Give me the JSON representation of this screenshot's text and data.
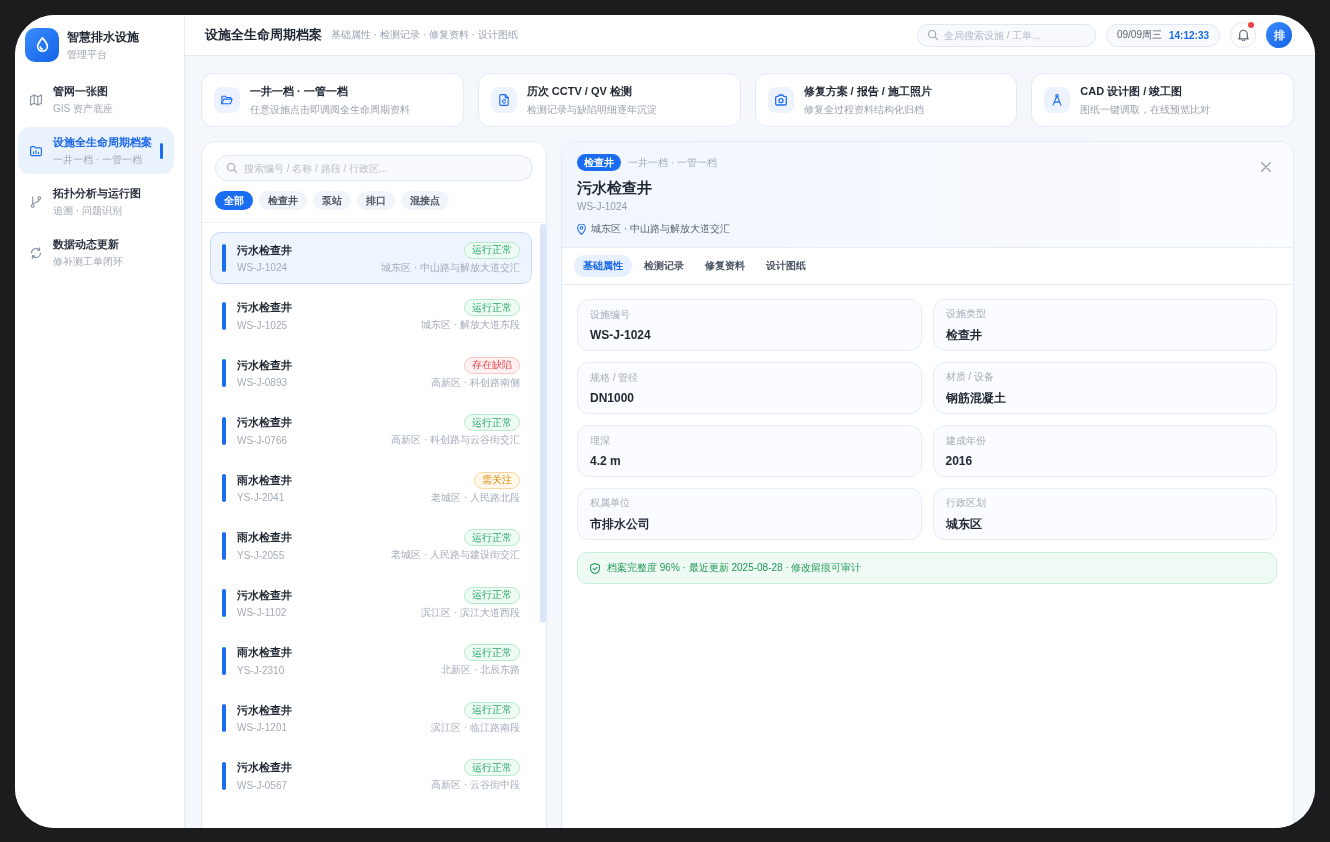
{
  "app": {
    "name": "智慧排水设施",
    "subtitle": "管理平台"
  },
  "sidebar": {
    "items": [
      {
        "title": "管网一张图",
        "subtitle": "GIS 资产底座",
        "selected": false
      },
      {
        "title": "设施全生命周期档案",
        "subtitle": "一井一档 · 一管一档",
        "selected": true
      },
      {
        "title": "拓扑分析与运行图",
        "subtitle": "追溯 · 问题识别",
        "selected": false
      },
      {
        "title": "数据动态更新",
        "subtitle": "修补测工单闭环",
        "selected": false
      }
    ]
  },
  "header": {
    "title": "设施全生命周期档案",
    "breadcrumb": "基础属性 · 检测记录 · 修复资料 · 设计图纸",
    "search": {
      "placeholder": "全局搜索设施 / 工单..."
    },
    "date": "09/09周三",
    "time": "14:12:33",
    "notifications": {
      "unread": true
    },
    "avatar": "排"
  },
  "feature_cards": [
    {
      "title": "一井一档 · 一管一档",
      "description": "任意设施点击即调阅全生命周期资料"
    },
    {
      "title": "历次 CCTV / QV 检测",
      "description": "检测记录与缺陷明细逐年沉淀"
    },
    {
      "title": "修复方案 / 报告 / 施工照片",
      "description": "修复全过程资料结构化归档"
    },
    {
      "title": "CAD 设计图 / 竣工图",
      "description": "图纸一键调取，在线预览比对"
    }
  ],
  "facility_list": {
    "search": {
      "placeholder": "搜索编号 / 名称 / 路段 / 行政区..."
    },
    "filters": [
      {
        "label": "全部",
        "selected": true
      },
      {
        "label": "检查井",
        "selected": false
      },
      {
        "label": "泵站",
        "selected": false
      },
      {
        "label": "排口",
        "selected": false
      },
      {
        "label": "混接点",
        "selected": false
      }
    ],
    "items": [
      {
        "name": "污水检查井",
        "code": "WS-J-1024",
        "location": "城东区 · 中山路与解放大道交汇",
        "kind": "normal",
        "status_label": "运行正常",
        "selected": true
      },
      {
        "name": "污水检查井",
        "code": "WS-J-1025",
        "location": "城东区 · 解放大道东段",
        "kind": "normal",
        "status_label": "运行正常",
        "selected": false
      },
      {
        "name": "污水检查井",
        "code": "WS-J-0893",
        "location": "高新区 · 科创路南侧",
        "kind": "defect",
        "status_label": "存在缺陷",
        "selected": false
      },
      {
        "name": "污水检查井",
        "code": "WS-J-0766",
        "location": "高新区 · 科创路与云谷街交汇",
        "kind": "normal",
        "status_label": "运行正常",
        "selected": false
      },
      {
        "name": "雨水检查井",
        "code": "YS-J-2041",
        "location": "老城区 · 人民路北段",
        "kind": "attention",
        "status_label": "需关注",
        "selected": false
      },
      {
        "name": "雨水检查井",
        "code": "YS-J-2055",
        "location": "老城区 · 人民路与建设街交汇",
        "kind": "normal",
        "status_label": "运行正常",
        "selected": false
      },
      {
        "name": "污水检查井",
        "code": "WS-J-1102",
        "location": "滨江区 · 滨江大道西段",
        "kind": "normal",
        "status_label": "运行正常",
        "selected": false
      },
      {
        "name": "雨水检查井",
        "code": "YS-J-2310",
        "location": "北新区 · 北辰东路",
        "kind": "normal",
        "status_label": "运行正常",
        "selected": false
      },
      {
        "name": "污水检查井",
        "code": "WS-J-1201",
        "location": "滨江区 · 临江路南段",
        "kind": "normal",
        "status_label": "运行正常",
        "selected": false
      },
      {
        "name": "污水检查井",
        "code": "WS-J-0567",
        "location": "高新区 · 云谷街中段",
        "kind": "normal",
        "status_label": "运行正常",
        "selected": false
      }
    ]
  },
  "detail": {
    "type_badge": "检查井",
    "tagline": "一井一档 · 一管一档",
    "title": "污水检查井",
    "code": "WS-J-1024",
    "location": "城东区 · 中山路与解放大道交汇",
    "tabs": [
      {
        "label": "基础属性",
        "selected": true
      },
      {
        "label": "检测记录",
        "selected": false
      },
      {
        "label": "修复资料",
        "selected": false
      },
      {
        "label": "设计图纸",
        "selected": false
      }
    ],
    "fields": [
      {
        "label": "设施编号",
        "value": "WS-J-1024"
      },
      {
        "label": "设施类型",
        "value": "检查井"
      },
      {
        "label": "规格 / 管径",
        "value": "DN1000"
      },
      {
        "label": "材质 / 设备",
        "value": "钢筋混凝土"
      },
      {
        "label": "埋深",
        "value": "4.2 m"
      },
      {
        "label": "建成年份",
        "value": "2016"
      },
      {
        "label": "权属单位",
        "value": "市排水公司"
      },
      {
        "label": "行政区划",
        "value": "城东区"
      }
    ],
    "summary": "档案完整度 96% · 最近更新 2025-08-28 · 修改留痕可审计"
  }
}
